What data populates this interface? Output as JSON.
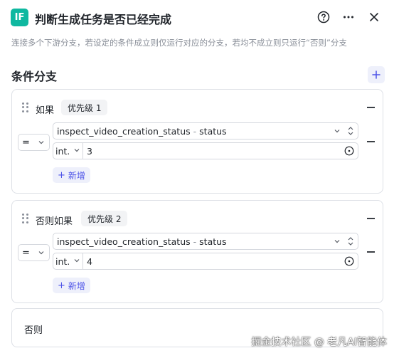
{
  "header": {
    "badge": "IF",
    "title": "判断生成任务是否已经完成",
    "icons": [
      "help-icon",
      "more-icon",
      "close-icon"
    ]
  },
  "description": "连接多个下游分支，若设定的条件成立则仅运行对应的分支，若均不成立则只运行“否则”分支",
  "section_title": "条件分支",
  "branches": [
    {
      "label": "如果",
      "priority": "优先级 1",
      "condition": {
        "operator": "=",
        "variable": "inspect_video_creation_status",
        "separator": "-",
        "field": "status",
        "value_type": "int.",
        "value": "3"
      },
      "add_label": "新增"
    },
    {
      "label": "否则如果",
      "priority": "优先级 2",
      "condition": {
        "operator": "=",
        "variable": "inspect_video_creation_status",
        "separator": "-",
        "field": "status",
        "value_type": "int.",
        "value": "4"
      },
      "add_label": "新增"
    }
  ],
  "else_label": "否则",
  "watermark": "掘金技术社区 @ 老凡AI智能体",
  "colors": {
    "accent": "#4d53e8",
    "badge": "#0fb8a0"
  }
}
